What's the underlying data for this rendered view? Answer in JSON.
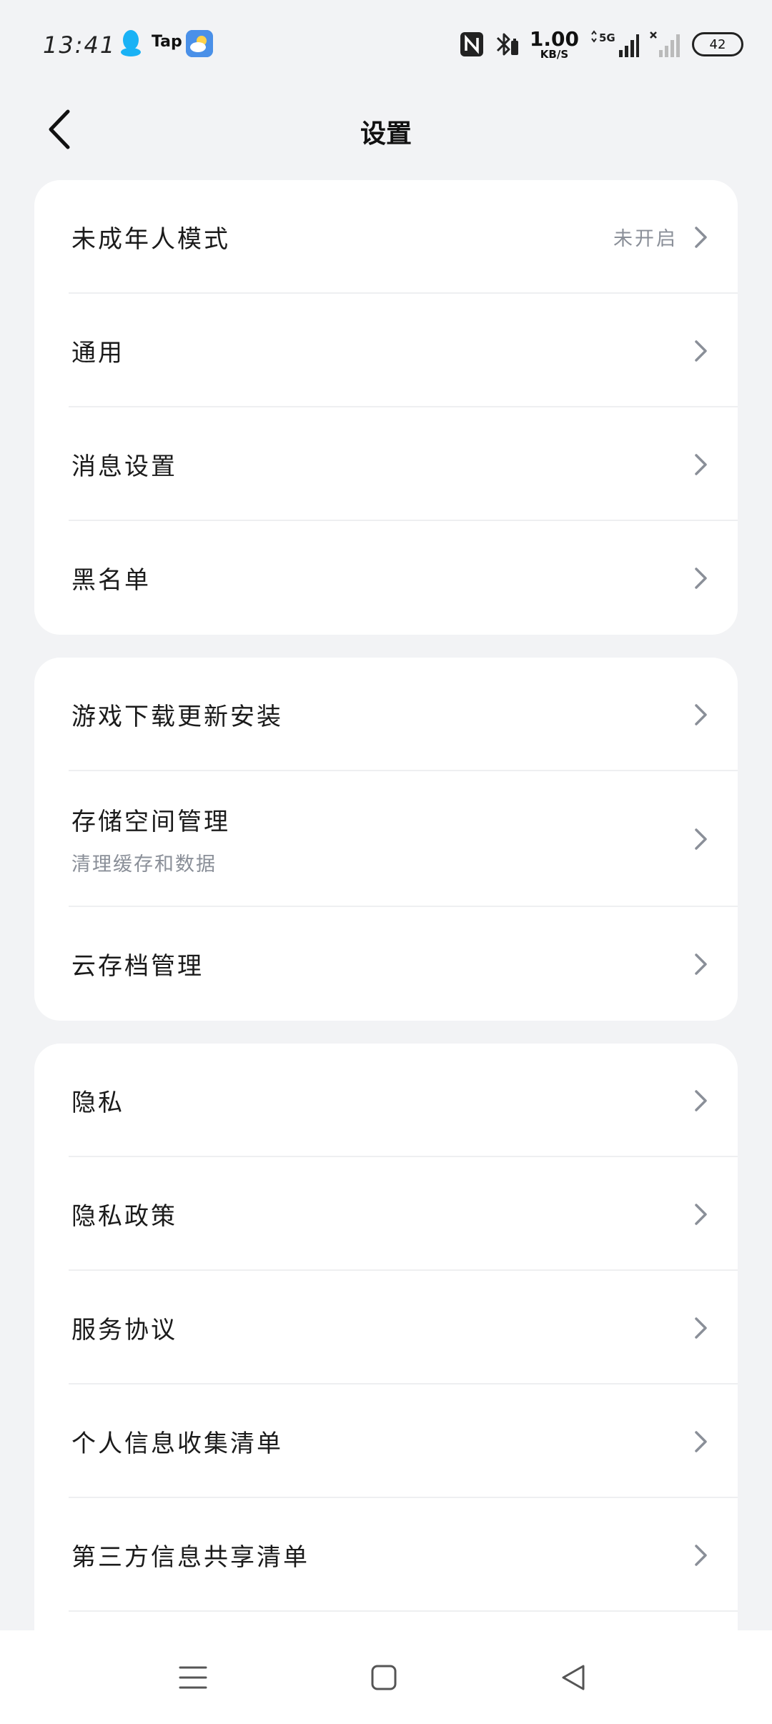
{
  "status_bar": {
    "time": "13:41",
    "tap_label": "Tap",
    "speed_value": "1.00",
    "speed_unit": "KB/S",
    "network_type": "5G",
    "battery_level": "42",
    "icons": [
      "qq-icon",
      "tap-icon",
      "weather-icon",
      "nfc-icon",
      "bluetooth-icon",
      "signal-icon",
      "signal-no-service-icon",
      "battery-icon"
    ]
  },
  "header": {
    "title": "设置",
    "back_icon": "chevron-left-icon"
  },
  "groups": [
    {
      "items": [
        {
          "label": "未成年人模式",
          "value": "未开启"
        },
        {
          "label": "通用"
        },
        {
          "label": "消息设置"
        },
        {
          "label": "黑名单"
        }
      ]
    },
    {
      "items": [
        {
          "label": "游戏下载更新安装"
        },
        {
          "label": "存储空间管理",
          "sub": "清理缓存和数据"
        },
        {
          "label": "云存档管理"
        }
      ]
    },
    {
      "items": [
        {
          "label": "隐私"
        },
        {
          "label": "隐私政策"
        },
        {
          "label": "服务协议"
        },
        {
          "label": "个人信息收集清单"
        },
        {
          "label": "第三方信息共享清单"
        }
      ]
    }
  ],
  "nav_bar": {
    "icons": [
      "menu-icon",
      "home-square-icon",
      "back-triangle-icon"
    ]
  },
  "colors": {
    "background": "#F2F3F5",
    "card": "#FFFFFF",
    "secondary_text": "#8A8F98",
    "chevron": "#8A8F98"
  }
}
